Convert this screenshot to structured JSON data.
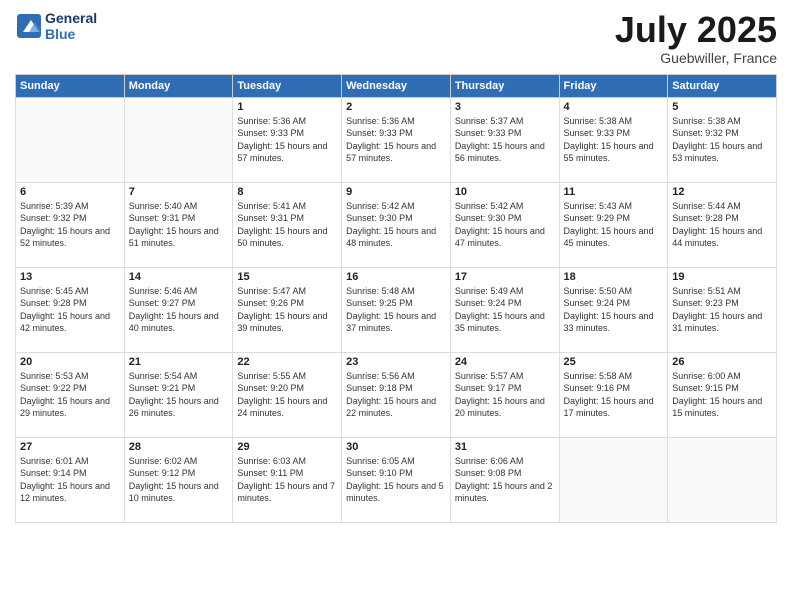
{
  "header": {
    "logo_line1": "General",
    "logo_line2": "Blue",
    "month": "July 2025",
    "location": "Guebwiller, France"
  },
  "weekdays": [
    "Sunday",
    "Monday",
    "Tuesday",
    "Wednesday",
    "Thursday",
    "Friday",
    "Saturday"
  ],
  "weeks": [
    [
      {
        "day": "",
        "empty": true
      },
      {
        "day": "",
        "empty": true
      },
      {
        "day": "1",
        "sunrise": "Sunrise: 5:36 AM",
        "sunset": "Sunset: 9:33 PM",
        "daylight": "Daylight: 15 hours and 57 minutes."
      },
      {
        "day": "2",
        "sunrise": "Sunrise: 5:36 AM",
        "sunset": "Sunset: 9:33 PM",
        "daylight": "Daylight: 15 hours and 57 minutes."
      },
      {
        "day": "3",
        "sunrise": "Sunrise: 5:37 AM",
        "sunset": "Sunset: 9:33 PM",
        "daylight": "Daylight: 15 hours and 56 minutes."
      },
      {
        "day": "4",
        "sunrise": "Sunrise: 5:38 AM",
        "sunset": "Sunset: 9:33 PM",
        "daylight": "Daylight: 15 hours and 55 minutes."
      },
      {
        "day": "5",
        "sunrise": "Sunrise: 5:38 AM",
        "sunset": "Sunset: 9:32 PM",
        "daylight": "Daylight: 15 hours and 53 minutes."
      }
    ],
    [
      {
        "day": "6",
        "sunrise": "Sunrise: 5:39 AM",
        "sunset": "Sunset: 9:32 PM",
        "daylight": "Daylight: 15 hours and 52 minutes."
      },
      {
        "day": "7",
        "sunrise": "Sunrise: 5:40 AM",
        "sunset": "Sunset: 9:31 PM",
        "daylight": "Daylight: 15 hours and 51 minutes."
      },
      {
        "day": "8",
        "sunrise": "Sunrise: 5:41 AM",
        "sunset": "Sunset: 9:31 PM",
        "daylight": "Daylight: 15 hours and 50 minutes."
      },
      {
        "day": "9",
        "sunrise": "Sunrise: 5:42 AM",
        "sunset": "Sunset: 9:30 PM",
        "daylight": "Daylight: 15 hours and 48 minutes."
      },
      {
        "day": "10",
        "sunrise": "Sunrise: 5:42 AM",
        "sunset": "Sunset: 9:30 PM",
        "daylight": "Daylight: 15 hours and 47 minutes."
      },
      {
        "day": "11",
        "sunrise": "Sunrise: 5:43 AM",
        "sunset": "Sunset: 9:29 PM",
        "daylight": "Daylight: 15 hours and 45 minutes."
      },
      {
        "day": "12",
        "sunrise": "Sunrise: 5:44 AM",
        "sunset": "Sunset: 9:28 PM",
        "daylight": "Daylight: 15 hours and 44 minutes."
      }
    ],
    [
      {
        "day": "13",
        "sunrise": "Sunrise: 5:45 AM",
        "sunset": "Sunset: 9:28 PM",
        "daylight": "Daylight: 15 hours and 42 minutes."
      },
      {
        "day": "14",
        "sunrise": "Sunrise: 5:46 AM",
        "sunset": "Sunset: 9:27 PM",
        "daylight": "Daylight: 15 hours and 40 minutes."
      },
      {
        "day": "15",
        "sunrise": "Sunrise: 5:47 AM",
        "sunset": "Sunset: 9:26 PM",
        "daylight": "Daylight: 15 hours and 39 minutes."
      },
      {
        "day": "16",
        "sunrise": "Sunrise: 5:48 AM",
        "sunset": "Sunset: 9:25 PM",
        "daylight": "Daylight: 15 hours and 37 minutes."
      },
      {
        "day": "17",
        "sunrise": "Sunrise: 5:49 AM",
        "sunset": "Sunset: 9:24 PM",
        "daylight": "Daylight: 15 hours and 35 minutes."
      },
      {
        "day": "18",
        "sunrise": "Sunrise: 5:50 AM",
        "sunset": "Sunset: 9:24 PM",
        "daylight": "Daylight: 15 hours and 33 minutes."
      },
      {
        "day": "19",
        "sunrise": "Sunrise: 5:51 AM",
        "sunset": "Sunset: 9:23 PM",
        "daylight": "Daylight: 15 hours and 31 minutes."
      }
    ],
    [
      {
        "day": "20",
        "sunrise": "Sunrise: 5:53 AM",
        "sunset": "Sunset: 9:22 PM",
        "daylight": "Daylight: 15 hours and 29 minutes."
      },
      {
        "day": "21",
        "sunrise": "Sunrise: 5:54 AM",
        "sunset": "Sunset: 9:21 PM",
        "daylight": "Daylight: 15 hours and 26 minutes."
      },
      {
        "day": "22",
        "sunrise": "Sunrise: 5:55 AM",
        "sunset": "Sunset: 9:20 PM",
        "daylight": "Daylight: 15 hours and 24 minutes."
      },
      {
        "day": "23",
        "sunrise": "Sunrise: 5:56 AM",
        "sunset": "Sunset: 9:18 PM",
        "daylight": "Daylight: 15 hours and 22 minutes."
      },
      {
        "day": "24",
        "sunrise": "Sunrise: 5:57 AM",
        "sunset": "Sunset: 9:17 PM",
        "daylight": "Daylight: 15 hours and 20 minutes."
      },
      {
        "day": "25",
        "sunrise": "Sunrise: 5:58 AM",
        "sunset": "Sunset: 9:16 PM",
        "daylight": "Daylight: 15 hours and 17 minutes."
      },
      {
        "day": "26",
        "sunrise": "Sunrise: 6:00 AM",
        "sunset": "Sunset: 9:15 PM",
        "daylight": "Daylight: 15 hours and 15 minutes."
      }
    ],
    [
      {
        "day": "27",
        "sunrise": "Sunrise: 6:01 AM",
        "sunset": "Sunset: 9:14 PM",
        "daylight": "Daylight: 15 hours and 12 minutes."
      },
      {
        "day": "28",
        "sunrise": "Sunrise: 6:02 AM",
        "sunset": "Sunset: 9:12 PM",
        "daylight": "Daylight: 15 hours and 10 minutes."
      },
      {
        "day": "29",
        "sunrise": "Sunrise: 6:03 AM",
        "sunset": "Sunset: 9:11 PM",
        "daylight": "Daylight: 15 hours and 7 minutes."
      },
      {
        "day": "30",
        "sunrise": "Sunrise: 6:05 AM",
        "sunset": "Sunset: 9:10 PM",
        "daylight": "Daylight: 15 hours and 5 minutes."
      },
      {
        "day": "31",
        "sunrise": "Sunrise: 6:06 AM",
        "sunset": "Sunset: 9:08 PM",
        "daylight": "Daylight: 15 hours and 2 minutes."
      },
      {
        "day": "",
        "empty": true
      },
      {
        "day": "",
        "empty": true
      }
    ]
  ]
}
